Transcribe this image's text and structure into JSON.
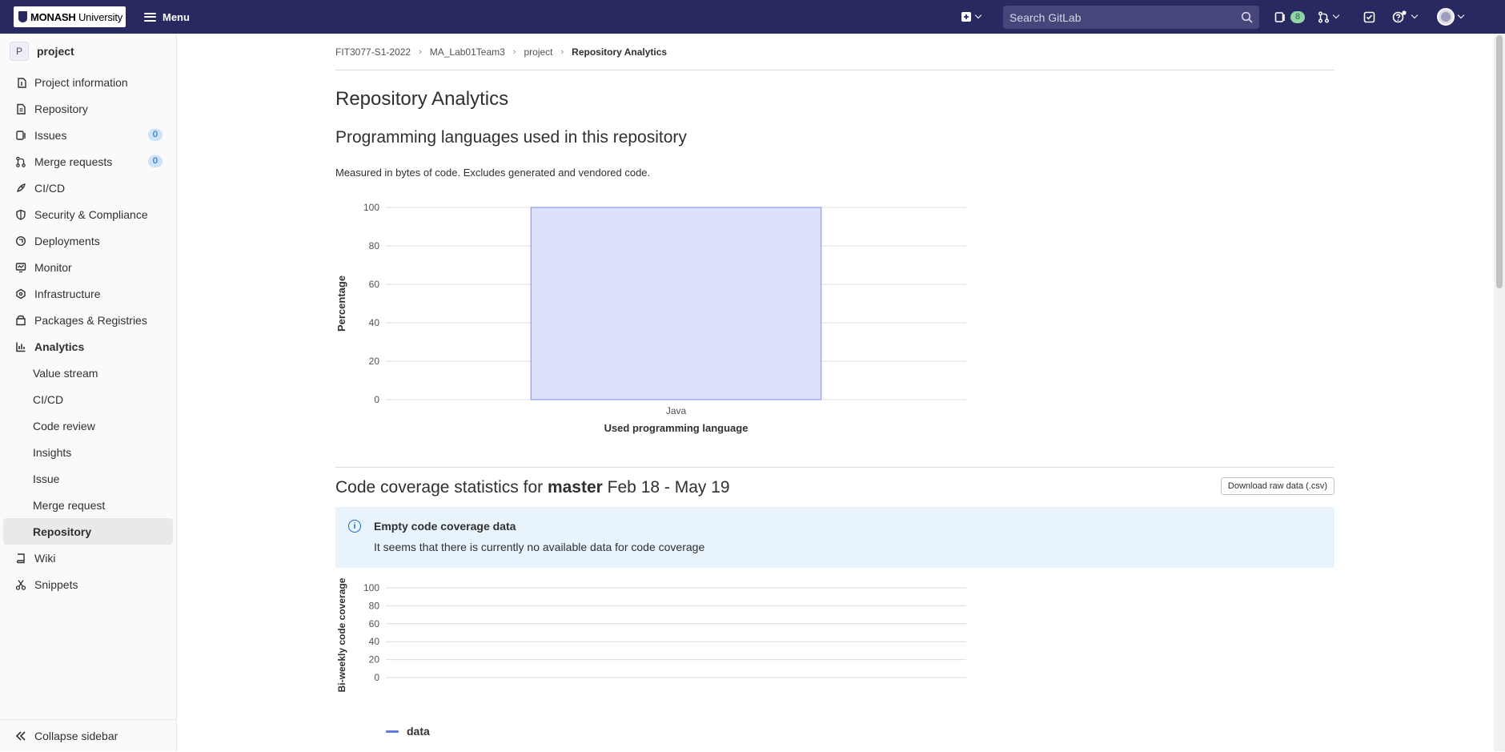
{
  "topbar": {
    "logo_text_bold": "MONASH",
    "logo_text_light": " University",
    "menu_label": "Menu",
    "search_placeholder": "Search GitLab",
    "issues_badge": "8"
  },
  "sidebar": {
    "project_initial": "P",
    "project_name": "project",
    "items": [
      {
        "label": "Project information",
        "icon": "info-icon"
      },
      {
        "label": "Repository",
        "icon": "doc-icon"
      },
      {
        "label": "Issues",
        "icon": "issues-icon",
        "count": "0"
      },
      {
        "label": "Merge requests",
        "icon": "merge-icon",
        "count": "0"
      },
      {
        "label": "CI/CD",
        "icon": "rocket-icon"
      },
      {
        "label": "Security & Compliance",
        "icon": "shield-icon"
      },
      {
        "label": "Deployments",
        "icon": "deploy-icon"
      },
      {
        "label": "Monitor",
        "icon": "monitor-icon"
      },
      {
        "label": "Infrastructure",
        "icon": "infra-icon"
      },
      {
        "label": "Packages & Registries",
        "icon": "package-icon"
      },
      {
        "label": "Analytics",
        "icon": "chart-icon"
      }
    ],
    "analytics_sub": [
      "Value stream",
      "CI/CD",
      "Code review",
      "Insights",
      "Issue",
      "Merge request",
      "Repository"
    ],
    "bottom_items": [
      {
        "label": "Wiki",
        "icon": "book-icon"
      },
      {
        "label": "Snippets",
        "icon": "scissors-icon"
      }
    ],
    "collapse_label": "Collapse sidebar"
  },
  "breadcrumb": [
    "FIT3077-S1-2022",
    "MA_Lab01Team3",
    "project",
    "Repository Analytics"
  ],
  "page_title": "Repository Analytics",
  "languages": {
    "title": "Programming languages used in this repository",
    "description": "Measured in bytes of code. Excludes generated and vendored code."
  },
  "coverage": {
    "title_prefix": "Code coverage statistics for ",
    "branch": "master",
    "range": " Feb 18 - May 19",
    "download_label": "Download raw data (.csv)",
    "alert_title": "Empty code coverage data",
    "alert_body": "It seems that there is currently no available data for code coverage",
    "legend_label": "data"
  },
  "colors": {
    "navbar": "#292961",
    "bar_fill": "#dde0fa",
    "bar_stroke": "#7b8df0",
    "legend_series": "#617ae2"
  },
  "chart_data": [
    {
      "type": "bar",
      "categories": [
        "Java"
      ],
      "values": [
        100
      ],
      "xlabel": "Used programming language",
      "ylabel": "Percentage",
      "ylim": [
        0,
        100
      ],
      "yticks": [
        0,
        20,
        40,
        60,
        80,
        100
      ],
      "grid": true
    },
    {
      "type": "line",
      "series": [
        {
          "name": "data",
          "values": []
        }
      ],
      "ylabel": "Bi-weekly code coverage",
      "ylim": [
        0,
        100
      ],
      "yticks": [
        0,
        20,
        40,
        60,
        80,
        100
      ],
      "grid": true
    }
  ]
}
